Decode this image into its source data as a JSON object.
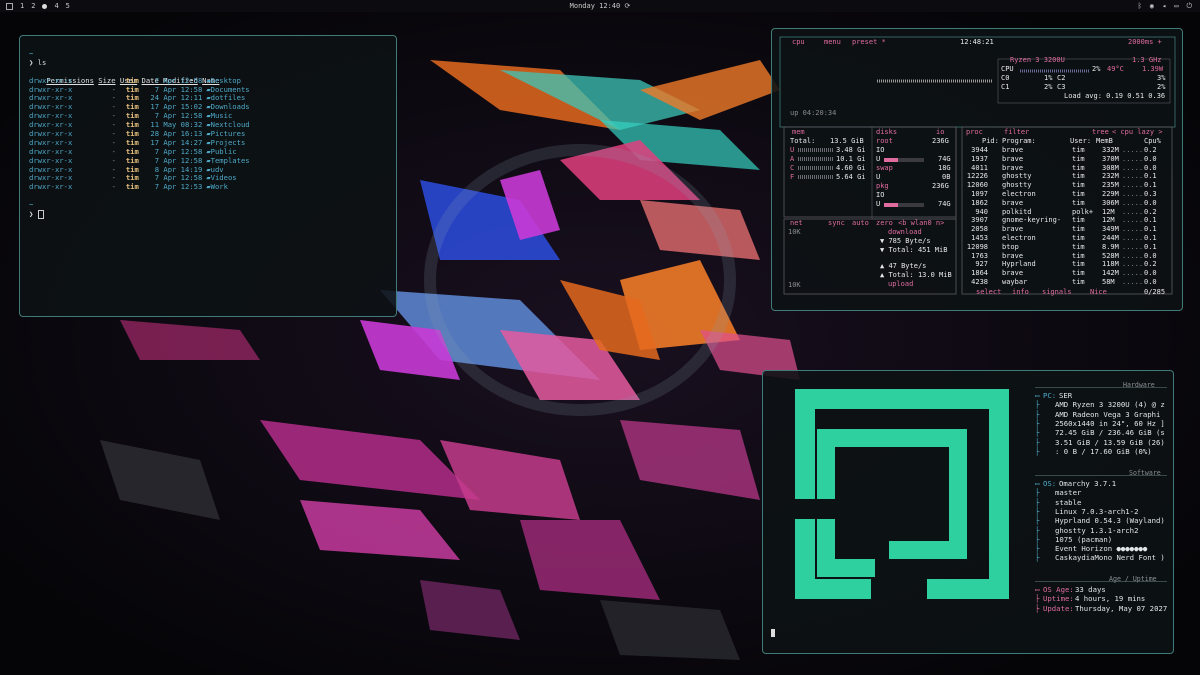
{
  "topbar": {
    "workspaces": [
      "1",
      "2",
      "4",
      "5"
    ],
    "clock": "Monday 12:40",
    "colors": {
      "bg": "#0c0c10"
    }
  },
  "terminal": {
    "prompt_symbol": "~",
    "command": "ls",
    "headers": [
      "Permissions",
      "Size",
      "User",
      "Date Modified",
      "Name"
    ],
    "rows": [
      {
        "perm": "drwxr-xr-x",
        "size": "-",
        "user": "tim",
        "date": "7 Apr 12:58",
        "name": "Desktop"
      },
      {
        "perm": "drwxr-xr-x",
        "size": "-",
        "user": "tim",
        "date": "7 Apr 12:58",
        "name": "Documents"
      },
      {
        "perm": "drwxr-xr-x",
        "size": "-",
        "user": "tim",
        "date": "24 Apr 12:11",
        "name": "dotfiles"
      },
      {
        "perm": "drwxr-xr-x",
        "size": "-",
        "user": "tim",
        "date": "17 Apr 15:02",
        "name": "Downloads"
      },
      {
        "perm": "drwxr-xr-x",
        "size": "-",
        "user": "tim",
        "date": "7 Apr 12:58",
        "name": "Music"
      },
      {
        "perm": "drwxr-xr-x",
        "size": "-",
        "user": "tim",
        "date": "11 May 08:32",
        "name": "Nextcloud"
      },
      {
        "perm": "drwxr-xr-x",
        "size": "-",
        "user": "tim",
        "date": "28 Apr 16:13",
        "name": "Pictures"
      },
      {
        "perm": "drwxr-xr-x",
        "size": "-",
        "user": "tim",
        "date": "17 Apr 14:27",
        "name": "Projects"
      },
      {
        "perm": "drwxr-xr-x",
        "size": "-",
        "user": "tim",
        "date": "7 Apr 12:58",
        "name": "Public"
      },
      {
        "perm": "drwxr-xr-x",
        "size": "-",
        "user": "tim",
        "date": "7 Apr 12:58",
        "name": "Templates"
      },
      {
        "perm": "drwxr-xr-x",
        "size": "-",
        "user": "tim",
        "date": "8 Apr 14:19",
        "name": "udv"
      },
      {
        "perm": "drwxr-xr-x",
        "size": "-",
        "user": "tim",
        "date": "7 Apr 12:58",
        "name": "Videos"
      },
      {
        "perm": "drwxr-xr-x",
        "size": "-",
        "user": "tim",
        "date": "7 Apr 12:53",
        "name": "Work"
      }
    ],
    "prompt2": "~"
  },
  "btop": {
    "top": {
      "cpu": "cpu",
      "menu": "menu",
      "preset": "preset *",
      "time": "12:48:21",
      "interval": "2000ms +"
    },
    "cpu": {
      "model": "Ryzen 3 3200U",
      "freq": "1.3 GHz",
      "rows": [
        {
          "label": "CPU",
          "pct": "2%",
          "temp": "49°C",
          "extra": "1.39W"
        },
        {
          "label": "C0",
          "pct": "1%",
          "label2": "C2",
          "pct2": "3%"
        },
        {
          "label": "C1",
          "pct": "2%",
          "label2": "C3",
          "pct2": "2%"
        }
      ],
      "load": "Load avg: 0.19 0.51 0.36",
      "uptime": "up 04:20:34"
    },
    "mem": {
      "title": "mem",
      "total_label": "Total:",
      "total": "13.5 GiB",
      "rows": [
        {
          "l": "U",
          "v": "3.48 Gi"
        },
        {
          "l": "A",
          "v": "10.1 Gi"
        },
        {
          "l": "C",
          "v": "4.60 Gi"
        },
        {
          "l": "F",
          "v": "5.64 Gi"
        }
      ]
    },
    "disks": {
      "title": "disks",
      "io": "io",
      "root": "root",
      "root_size": "236G",
      "io_l": "IO",
      "u_l": "U",
      "root_used": "74G",
      "swap": "swap",
      "swap_size": "18G",
      "swap_used": "0B",
      "pkg": "pkg",
      "pkg_size": "236G",
      "pkg_used": "74G"
    },
    "net": {
      "title": "net",
      "sync": "sync",
      "auto": "auto",
      "zero": "zero",
      "iface": "<b wlan0 n>",
      "scale_top": "10K",
      "scale_bot": "10K",
      "download": "download",
      "dl_rate": "785 Byte/s",
      "dl_total": "Total:  451 MiB",
      "ul_rate": "47 Byte/s",
      "ul_total": "Total: 13.0 MiB",
      "upload": "upload"
    },
    "proc": {
      "title": "proc",
      "filter": "filter",
      "tree": "tree",
      "cpu_lazy": "< cpu lazy >",
      "headers": [
        "Pid:",
        "Program:",
        "User:",
        "MemB",
        "Cpu%"
      ],
      "rows": [
        {
          "pid": "3944",
          "prog": "brave",
          "user": "tim",
          "mem": "332M",
          "cpu": "0.2"
        },
        {
          "pid": "1937",
          "prog": "brave",
          "user": "tim",
          "mem": "370M",
          "cpu": "0.0"
        },
        {
          "pid": "4011",
          "prog": "brave",
          "user": "tim",
          "mem": "308M",
          "cpu": "0.0"
        },
        {
          "pid": "12226",
          "prog": "ghostty",
          "user": "tim",
          "mem": "232M",
          "cpu": "0.1"
        },
        {
          "pid": "12060",
          "prog": "ghostty",
          "user": "tim",
          "mem": "235M",
          "cpu": "0.1"
        },
        {
          "pid": "1097",
          "prog": "electron",
          "user": "tim",
          "mem": "229M",
          "cpu": "0.3"
        },
        {
          "pid": "1862",
          "prog": "brave",
          "user": "tim",
          "mem": "306M",
          "cpu": "0.0"
        },
        {
          "pid": "940",
          "prog": "polkitd",
          "user": "polk+",
          "mem": "12M",
          "cpu": "0.2"
        },
        {
          "pid": "3907",
          "prog": "gnome-keyring-",
          "user": "tim",
          "mem": "12M",
          "cpu": "0.1"
        },
        {
          "pid": "2058",
          "prog": "brave",
          "user": "tim",
          "mem": "349M",
          "cpu": "0.1"
        },
        {
          "pid": "1453",
          "prog": "electron",
          "user": "tim",
          "mem": "244M",
          "cpu": "0.1"
        },
        {
          "pid": "12098",
          "prog": "btop",
          "user": "tim",
          "mem": "8.9M",
          "cpu": "0.1"
        },
        {
          "pid": "1763",
          "prog": "brave",
          "user": "tim",
          "mem": "528M",
          "cpu": "0.0"
        },
        {
          "pid": "927",
          "prog": "Hyprland",
          "user": "tim",
          "mem": "118M",
          "cpu": "0.2"
        },
        {
          "pid": "1864",
          "prog": "brave",
          "user": "tim",
          "mem": "142M",
          "cpu": "0.0"
        },
        {
          "pid": "4238",
          "prog": "waybar",
          "user": "tim",
          "mem": "58M",
          "cpu": "0.0"
        }
      ],
      "bottom": {
        "select": "select",
        "info": "info",
        "signals": "signals",
        "nice": "Nice",
        "count": "0/285"
      }
    }
  },
  "fastfetch": {
    "hardware_title": "Hardware",
    "hardware": [
      {
        "k": "PC:",
        "v": "SER"
      },
      {
        "k": "",
        "v": "AMD Ryzen 3 3200U (4) @ z"
      },
      {
        "k": "",
        "v": "AMD Radeon Vega 3 Graphi"
      },
      {
        "k": "",
        "v": "2560x1440 in 24\", 60 Hz ]"
      },
      {
        "k": "",
        "v": "72.45 GiB / 236.46 GiB (s"
      },
      {
        "k": "",
        "v": "3.51 GiB / 13.59 GiB (26)"
      },
      {
        "k": "",
        "v": ": 0 B / 17.60 GiB (0%)"
      }
    ],
    "software_title": "Software",
    "software": [
      {
        "k": "OS:",
        "v": "Omarchy 3.7.1"
      },
      {
        "k": "",
        "v": "master"
      },
      {
        "k": "",
        "v": "stable"
      },
      {
        "k": "",
        "v": "Linux 7.0.3-arch1-2"
      },
      {
        "k": "",
        "v": "Hyprland 0.54.3 (Wayland)"
      },
      {
        "k": "",
        "v": "ghostty 1.3.1-arch2"
      },
      {
        "k": "",
        "v": "1075 (pacman)"
      },
      {
        "k": "",
        "v": "Event Horizon ●●●●●●●"
      },
      {
        "k": "",
        "v": "CaskaydiaMono Nerd Font )"
      }
    ],
    "age_title": "Age / Uptime",
    "age": [
      {
        "k": "OS Age:",
        "v": "33 days"
      },
      {
        "k": "Uptime:",
        "v": "4 hours, 19 mins"
      },
      {
        "k": "Update:",
        "v": "Thursday, May 07 2027"
      }
    ],
    "logo_color": "#2fd0a0"
  }
}
